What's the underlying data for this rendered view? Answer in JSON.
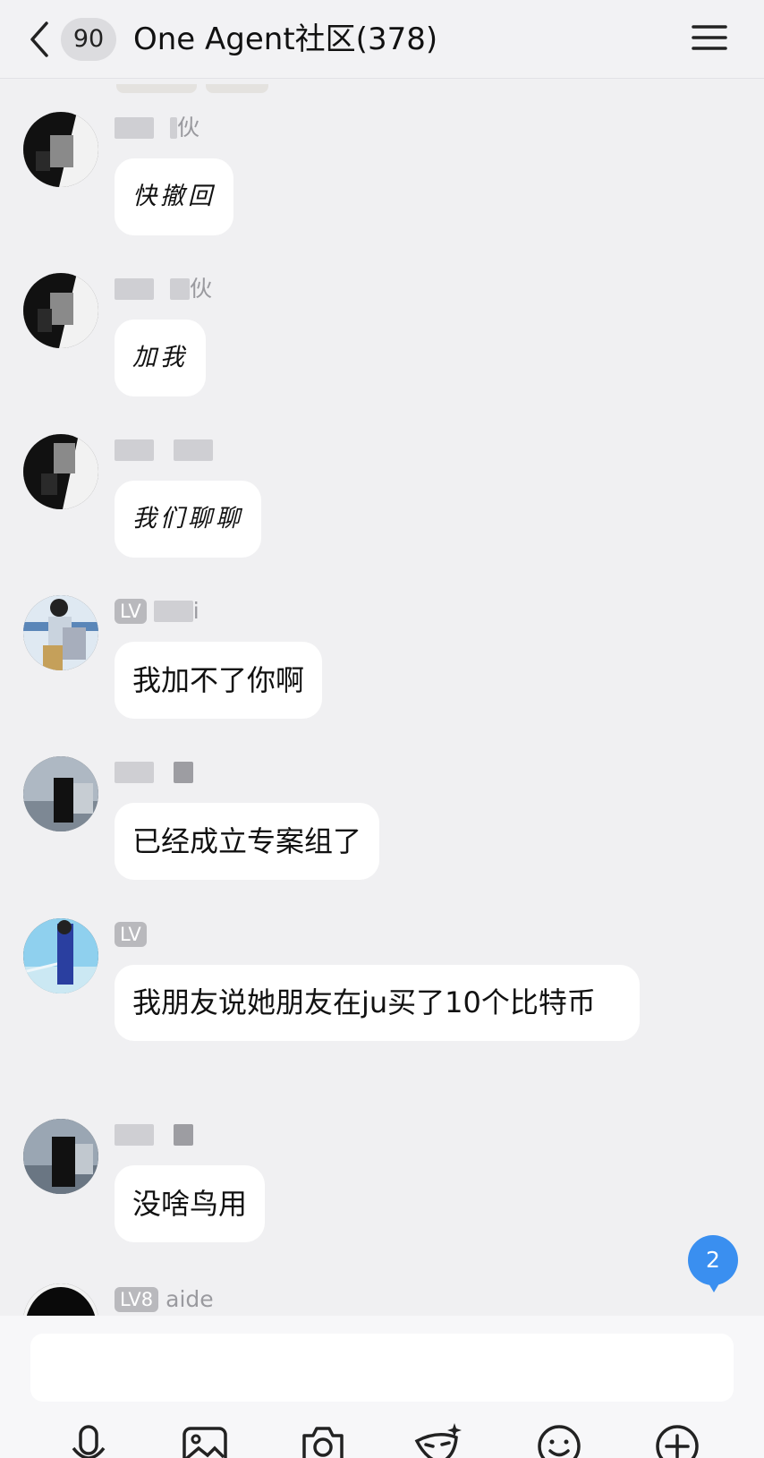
{
  "header": {
    "unread_count": "90",
    "title": "One Agent社区(378)"
  },
  "messages": [
    {
      "name_fragment": "伙",
      "text": "快撤回",
      "style": "handwritten"
    },
    {
      "name_fragment": "伙",
      "text": "加我",
      "style": "handwritten"
    },
    {
      "name_fragment": "",
      "text": "我们聊聊",
      "style": "handwritten"
    },
    {
      "level": "LV",
      "name_fragment": "i",
      "text": "我加不了你啊"
    },
    {
      "name_fragment": "",
      "text": "已经成立专案组了"
    },
    {
      "level": "LV",
      "name_fragment": "",
      "text": "我朋友说她朋友在ju买了10个比特币"
    },
    {
      "name_fragment": "",
      "text": "没啥鸟用"
    },
    {
      "level": "LV8",
      "name_fragment": "aide",
      "text": ""
    }
  ],
  "new_message_badge": "2",
  "input": {
    "value": ""
  },
  "toolbar": {
    "icons": [
      "microphone-icon",
      "image-icon",
      "camera-icon",
      "mask-icon",
      "emoji-icon",
      "plus-icon"
    ]
  },
  "colors": {
    "accent": "#3a8ff0",
    "bubble": "#ffffff",
    "background": "#f0f0f2"
  }
}
